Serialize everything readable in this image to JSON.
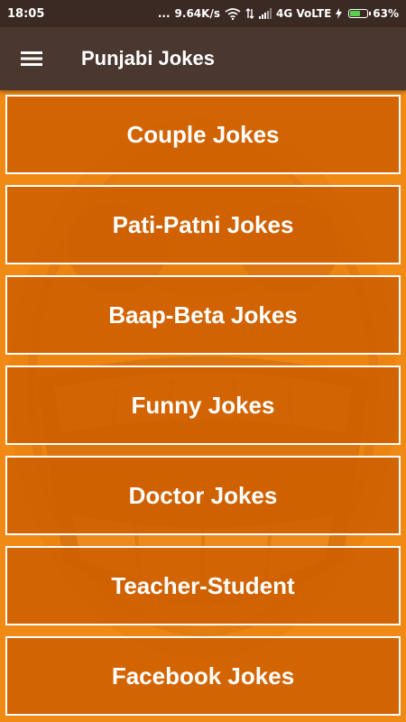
{
  "status_bar": {
    "time": "18:05",
    "dots": "...",
    "speed": "9.64K/s",
    "network": "4G VoLTE",
    "battery_percent": "63%",
    "battery_level": 0.63
  },
  "app_bar": {
    "menu_icon": "hamburger-menu-icon",
    "title": "Punjabi Jokes"
  },
  "categories": [
    {
      "label": "Couple Jokes"
    },
    {
      "label": "Pati-Patni Jokes"
    },
    {
      "label": "Baap-Beta Jokes"
    },
    {
      "label": "Funny Jokes"
    },
    {
      "label": "Doctor Jokes"
    },
    {
      "label": "Teacher-Student"
    },
    {
      "label": "Facebook Jokes"
    }
  ],
  "colors": {
    "status_bar": "#3B2A23",
    "app_bar": "#4A372F",
    "background": "#F08A14",
    "button_fill": "#CE5F00",
    "button_border": "#FFFFFF",
    "text": "#FFFFFF",
    "battery": "#55D24B"
  }
}
